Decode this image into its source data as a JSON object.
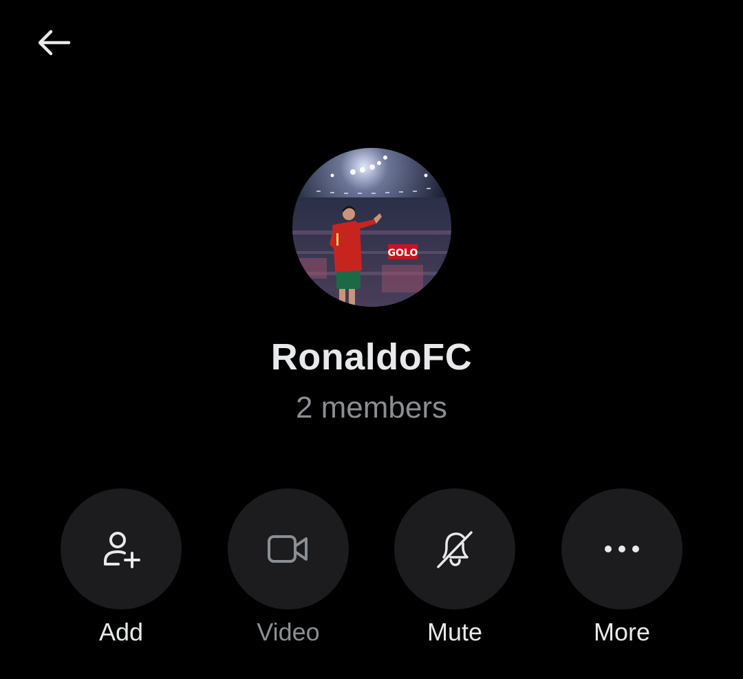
{
  "header": {
    "back_icon": "arrow-left-icon"
  },
  "group": {
    "name": "RonaldoFC",
    "members": "2 members",
    "avatar_sign_text": "GOLO"
  },
  "actions": [
    {
      "label": "Add",
      "icon": "add-person-icon",
      "enabled": true
    },
    {
      "label": "Video",
      "icon": "video-camera-icon",
      "enabled": false
    },
    {
      "label": "Mute",
      "icon": "bell-off-icon",
      "enabled": true
    },
    {
      "label": "More",
      "icon": "more-dots-icon",
      "enabled": true
    }
  ],
  "colors": {
    "background": "#000000",
    "button_bg": "#1c1c1e",
    "text_primary": "#e7e9ea",
    "text_secondary": "#8b8f94"
  }
}
